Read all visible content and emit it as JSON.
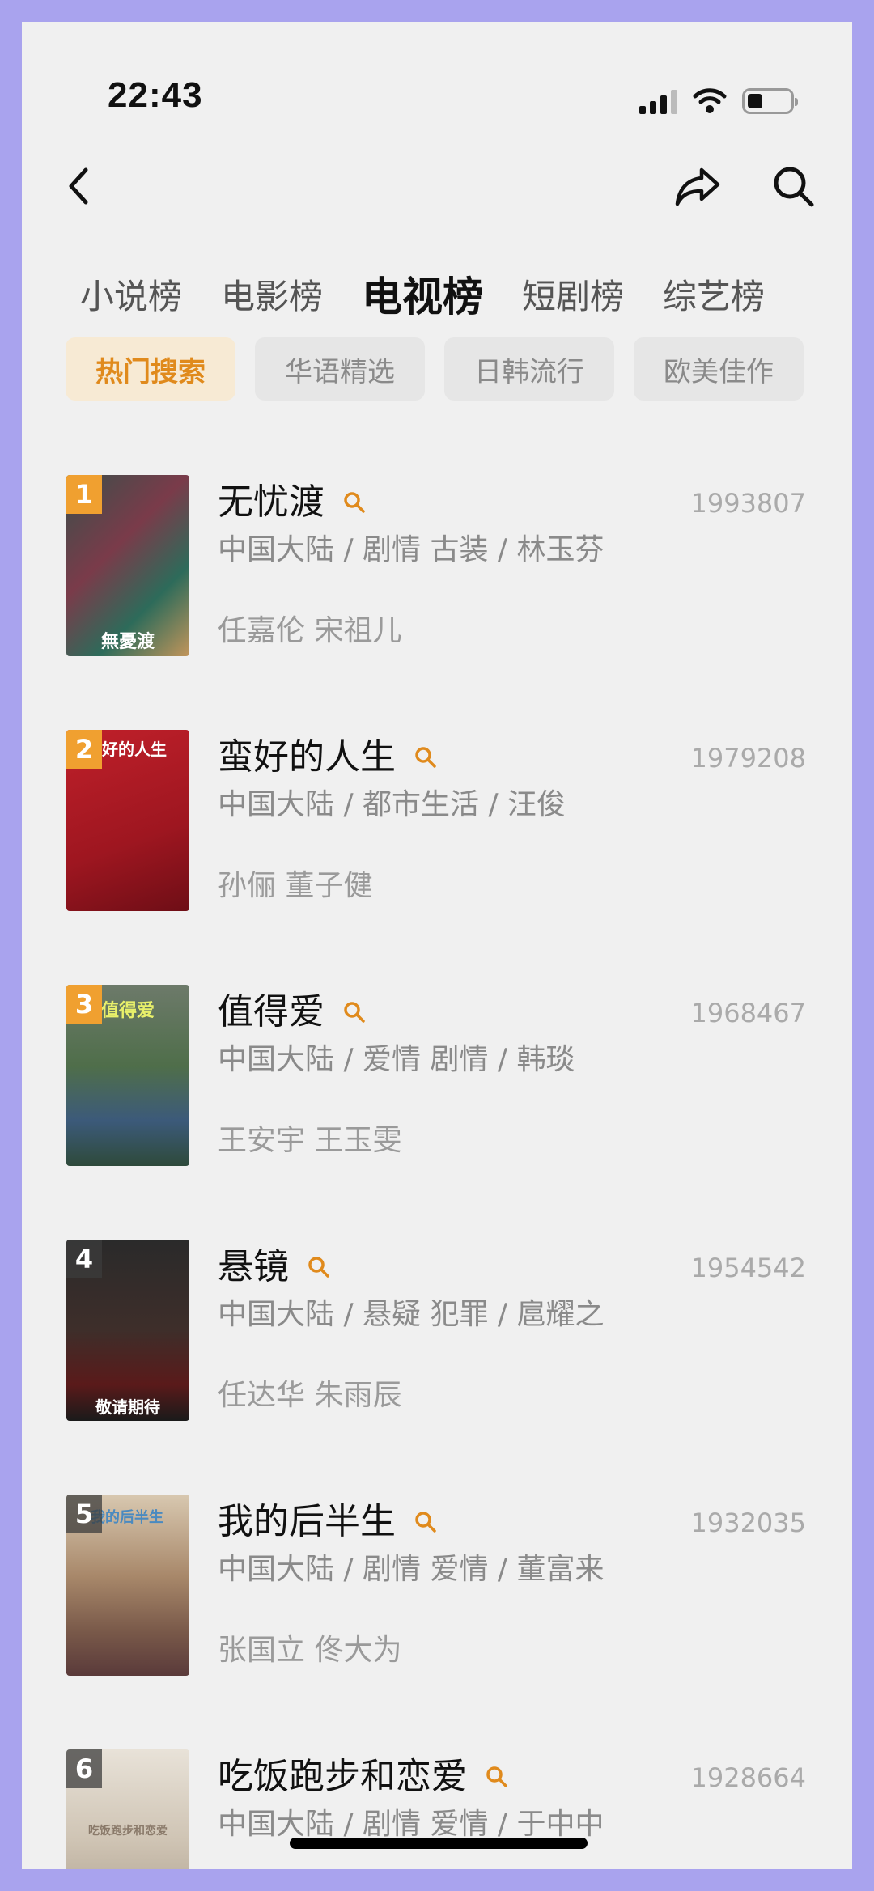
{
  "status_bar": {
    "time": "22:43",
    "battery_level_pct": 35
  },
  "nav": {
    "back_icon": "chevron-left-icon",
    "share_icon": "share-icon",
    "search_icon": "search-icon"
  },
  "tabs": [
    {
      "label": "小说榜",
      "active": false
    },
    {
      "label": "电影榜",
      "active": false
    },
    {
      "label": "电视榜",
      "active": true
    },
    {
      "label": "短剧榜",
      "active": false
    },
    {
      "label": "综艺榜",
      "active": false
    }
  ],
  "chips": [
    {
      "label": "热门搜索",
      "active": true
    },
    {
      "label": "华语精选",
      "active": false
    },
    {
      "label": "日韩流行",
      "active": false
    },
    {
      "label": "欧美佳作",
      "active": false
    }
  ],
  "colors": {
    "accent": "#e08a1c",
    "rank_top": "#f0a030",
    "background": "#f0f0f0",
    "frame": "#a9a3ee"
  },
  "items": [
    {
      "rank": "1",
      "title": "无忧渡",
      "meta": "中国大陆 / 剧情 古装 / 林玉芬",
      "cast": "任嘉伦 宋祖儿",
      "count": "1993807",
      "poster_text": "無憂渡"
    },
    {
      "rank": "2",
      "title": "蛮好的人生",
      "meta": "中国大陆 / 都市生活 / 汪俊",
      "cast": "孙俪 董子健",
      "count": "1979208",
      "poster_text": "蛮好的人生"
    },
    {
      "rank": "3",
      "title": "值得爱",
      "meta": "中国大陆 / 爱情 剧情 / 韩琰",
      "cast": "王安宇 王玉雯",
      "count": "1968467",
      "poster_text": "值得爱"
    },
    {
      "rank": "4",
      "title": "悬镜",
      "meta": "中国大陆 / 悬疑 犯罪 / 扈耀之",
      "cast": "任达华 朱雨辰",
      "count": "1954542",
      "poster_text": "敬请期待"
    },
    {
      "rank": "5",
      "title": "我的后半生",
      "meta": "中国大陆 / 剧情 爱情 / 董富来",
      "cast": "张国立 佟大为",
      "count": "1932035",
      "poster_text": "我的后半生"
    },
    {
      "rank": "6",
      "title": "吃饭跑步和恋爱",
      "meta": "中国大陆 / 剧情 爱情 / 于中中",
      "cast": "",
      "count": "1928664",
      "poster_text": "吃饭跑步和恋爱"
    }
  ]
}
